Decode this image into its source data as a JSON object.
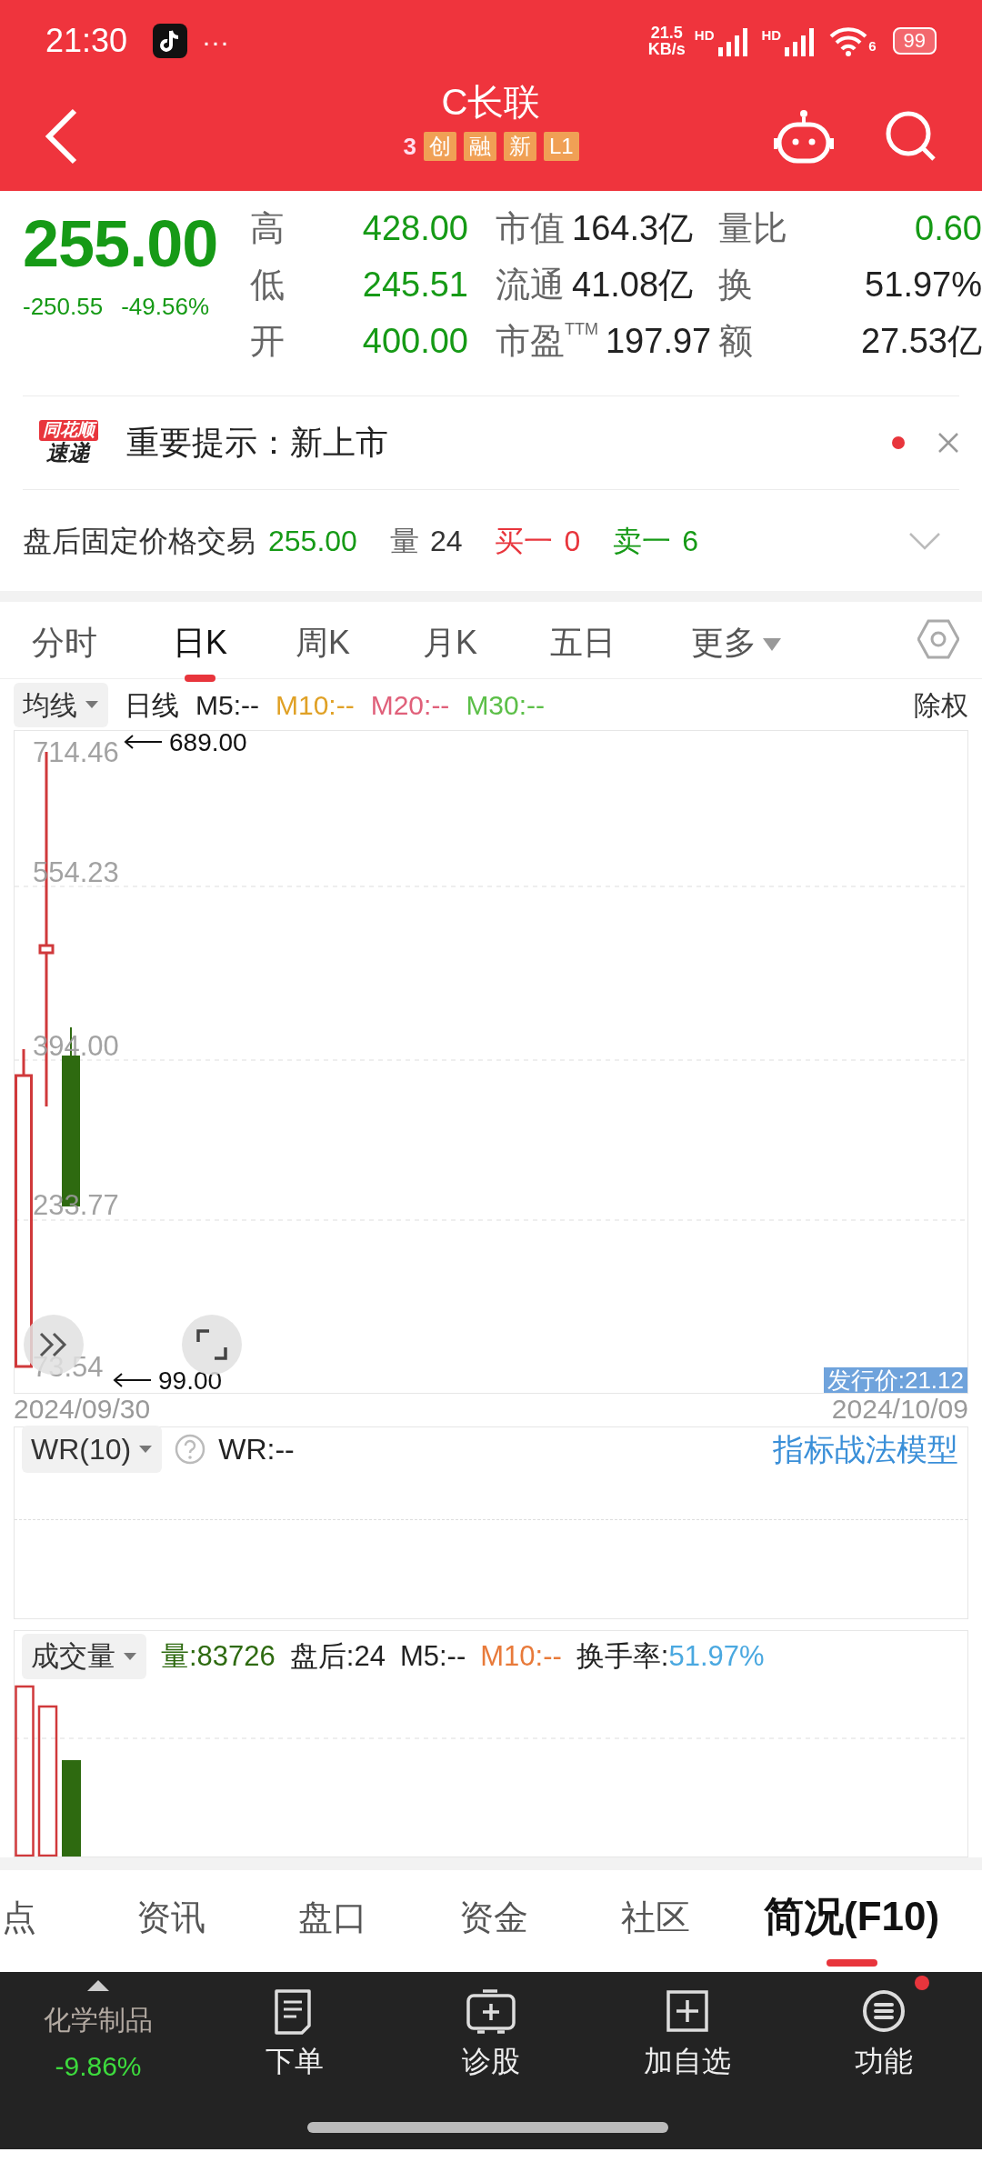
{
  "status_bar": {
    "time": "21:30",
    "more": "···",
    "speed_value": "21.5",
    "speed_unit": "KB/s",
    "hd_labels": [
      "HD",
      "HD"
    ],
    "wifi_label": "6",
    "battery": "99"
  },
  "header": {
    "title": "C长联",
    "code": "3",
    "tags": [
      "创",
      "融",
      "新",
      "L1"
    ]
  },
  "quote": {
    "price": "255.00",
    "change": "-250.55",
    "change_pct": "-49.56%",
    "stats": [
      [
        {
          "label": "高",
          "value": "428.00",
          "kind": "price"
        },
        {
          "label": "市值",
          "value": "164.3亿",
          "kind": "plain"
        },
        {
          "label": "量比",
          "value": "0.60",
          "kind": "price"
        }
      ],
      [
        {
          "label": "低",
          "value": "245.51",
          "kind": "price"
        },
        {
          "label": "流通",
          "value": "41.08亿",
          "kind": "plain"
        },
        {
          "label": "换",
          "value": "51.97%",
          "kind": "plain"
        }
      ],
      [
        {
          "label": "开",
          "value": "400.00",
          "kind": "price"
        },
        {
          "label": "市盈$^{TTM}$",
          "value": "197.97",
          "kind": "plain"
        },
        {
          "label": "额",
          "value": "27.53亿",
          "kind": "plain"
        }
      ]
    ]
  },
  "notice": {
    "logo_top": "同花顺",
    "logo_bottom": "速递",
    "text": "重要提示：新上市",
    "unread": true
  },
  "after_hours": {
    "label": "盘后固定价格交易",
    "price": "255.00",
    "items": [
      {
        "label": "量",
        "value": "24",
        "kind": "plain"
      },
      {
        "label": "买一",
        "value": "0",
        "kind": "buy"
      },
      {
        "label": "卖一",
        "value": "6",
        "kind": "sell"
      }
    ]
  },
  "chart_tabs": [
    {
      "label": "分时",
      "selected": false
    },
    {
      "label": "日K",
      "selected": true
    },
    {
      "label": "周K",
      "selected": false
    },
    {
      "label": "月K",
      "selected": false
    },
    {
      "label": "五日",
      "selected": false
    },
    {
      "label": "更多",
      "selected": false,
      "dropdown": true
    }
  ],
  "ma_bar": {
    "selector": "均线",
    "period": "日线",
    "lines": [
      {
        "label": "M5:--",
        "color": "#222222"
      },
      {
        "label": "M10:--",
        "color": "#e0a126"
      },
      {
        "label": "M20:--",
        "color": "#e0607a"
      },
      {
        "label": "M30:--",
        "color": "#5cbf48"
      }
    ],
    "adjust": "除权"
  },
  "kline": {
    "y_labels": [
      "714.46",
      "554.23",
      "394.00",
      "233.77",
      "73.54"
    ],
    "high_marker": "689.00",
    "low_marker": "99.00",
    "issue_price": "发行价:21.12",
    "dates": [
      "2024/09/30",
      "2024/10/09"
    ]
  },
  "wr_panel": {
    "selector": "WR(10)",
    "value": "WR:--",
    "link": "指标战法模型"
  },
  "volume_panel": {
    "selector": "成交量",
    "items": [
      {
        "text": "量:83726",
        "color": "#2e6a10"
      },
      {
        "text": "盘后:24",
        "color": "#222222"
      },
      {
        "text": "M5:--",
        "color": "#222222"
      },
      {
        "text": "M10:--",
        "color": "#e87a3a"
      },
      {
        "text": "换手率:**51.97%**",
        "color": "#222222"
      }
    ]
  },
  "bottom_tabs": [
    {
      "label": "点",
      "selected": false
    },
    {
      "label": "资讯",
      "selected": false
    },
    {
      "label": "盘口",
      "selected": false
    },
    {
      "label": "资金",
      "selected": false
    },
    {
      "label": "社区",
      "selected": false
    },
    {
      "label": "简况(F10)",
      "selected": true
    }
  ],
  "bottom_bar": {
    "sector": "化学制品",
    "sector_change": "-9.86%",
    "actions": [
      {
        "label": "下单",
        "kind": "order",
        "badge": false
      },
      {
        "label": "诊股",
        "kind": "diagnose",
        "badge": false
      },
      {
        "label": "加自选",
        "kind": "add",
        "badge": false
      },
      {
        "label": "功能",
        "kind": "menu",
        "badge": true
      }
    ]
  }
}
